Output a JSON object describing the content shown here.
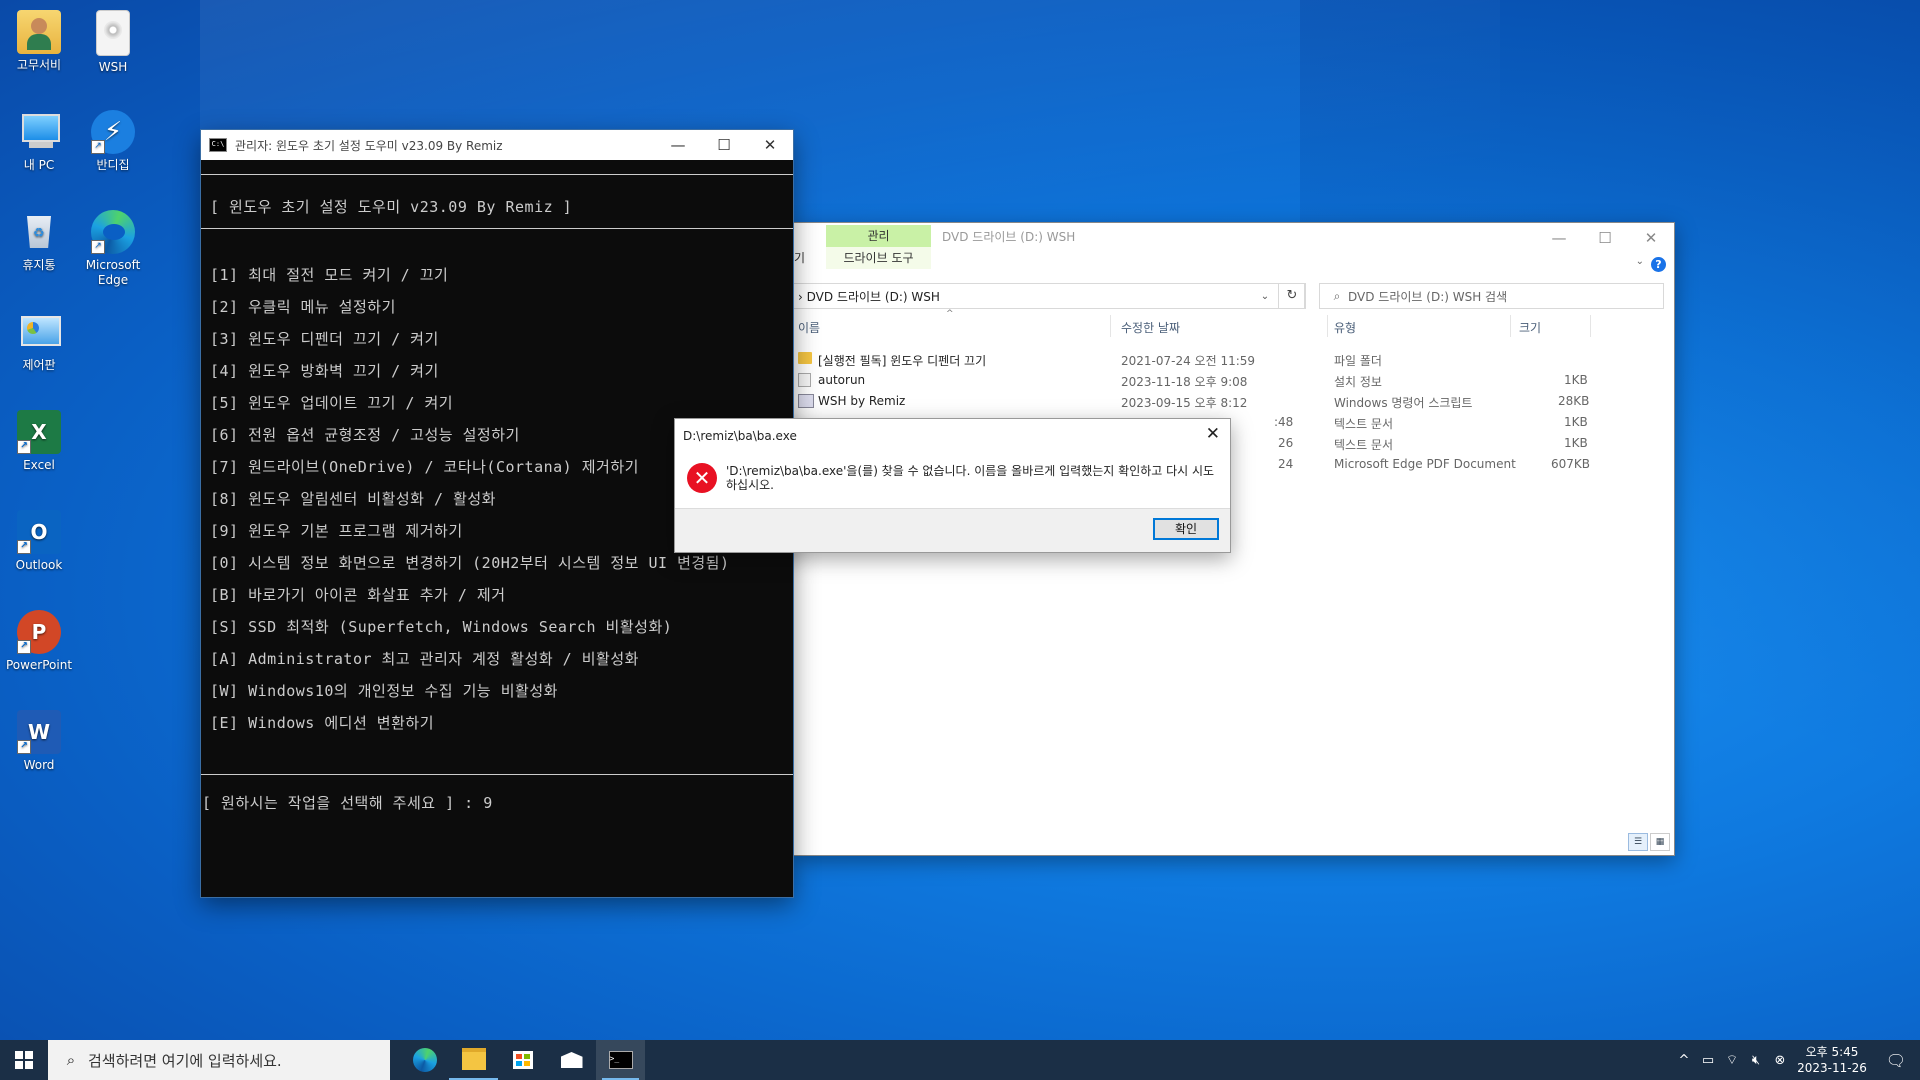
{
  "desktop": {
    "icons": [
      {
        "label": "고무서비"
      },
      {
        "label": "WSH"
      },
      {
        "label": "내 PC"
      },
      {
        "label": "반디집"
      },
      {
        "label": "휴지통"
      },
      {
        "label": "Microsoft Edge"
      },
      {
        "label": "제어판"
      },
      {
        "label": "Excel"
      },
      {
        "label": "Outlook"
      },
      {
        "label": "PowerPoint"
      },
      {
        "label": "Word"
      }
    ]
  },
  "console": {
    "title": "관리자:  윈도우 초기 설정 도우미 v23.09 By Remiz",
    "header": "[ 윈도우 초기 설정 도우미 v23.09 By Remiz ]",
    "menu": [
      "[1] 최대 절전 모드 켜기 / 끄기",
      "[2] 우클릭 메뉴 설정하기",
      "[3] 윈도우 디펜더 끄기 / 켜기",
      "[4] 윈도우 방화벽 끄기 / 켜기",
      "[5] 윈도우 업데이트 끄기 / 켜기",
      "[6] 전원 옵션 균형조정 / 고성능 설정하기",
      "[7] 원드라이브(OneDrive) / 코타나(Cortana) 제거하기",
      "[8] 윈도우 알림센터 비활성화 / 활성화",
      "[9] 윈도우 기본 프로그램 제거하기",
      "[0] 시스템 정보 화면으로 변경하기 (20H2부터 시스템 정보 UI 변경됨)",
      "[B] 바로가기 아이콘 화살표 추가 / 제거",
      "[S] SSD 최적화 (Superfetch, Windows Search 비활성화)",
      "[A] Administrator 최고 관리자 계정 활성화 / 비활성화",
      "[W] Windows10의 개인정보 수집 기능 비활성화",
      "[E] Windows 에디션 변환하기"
    ],
    "prompt": "[ 원하시는 작업을 선택해 주세요 ] : 9"
  },
  "explorer": {
    "ribbon_tab": "관리",
    "ribbon_sub": "드라이브 도구",
    "left_trunc": "기",
    "title": "DVD 드라이브 (D:) WSH",
    "address": "DVD 드라이브 (D:) WSH",
    "search_placeholder": "DVD 드라이브 (D:) WSH 검색",
    "columns": {
      "name": "이름",
      "date": "수정한 날짜",
      "type": "유형",
      "size": "크기"
    },
    "files": [
      {
        "name": "[실행전 필독] 윈도우 디펜더 끄기",
        "date": "2021-07-24 오전 11:59",
        "type": "파일 폴더",
        "size": "",
        "icon": "folder-icon"
      },
      {
        "name": "autorun",
        "date": "2023-11-18 오후 9:08",
        "type": "설치 정보",
        "size": "1KB",
        "icon": "settings-file-icon"
      },
      {
        "name": "WSH by Remiz",
        "date": "2023-09-15 오후 8:12",
        "type": "Windows 명령어 스크립트",
        "size": "28KB",
        "icon": "script-icon"
      },
      {
        "name": "",
        "date": ":48",
        "type": "텍스트 문서",
        "size": "1KB",
        "icon": "text-file-icon"
      },
      {
        "name": "",
        "date": "26",
        "type": "텍스트 문서",
        "size": "1KB",
        "icon": ""
      },
      {
        "name": "",
        "date": "24",
        "type": "Microsoft Edge PDF Document",
        "size": "607KB",
        "icon": ""
      }
    ]
  },
  "dialog": {
    "title": "D:\\remiz\\ba\\ba.exe",
    "message": "'D:\\remiz\\ba\\ba.exe'을(를) 찾을 수 없습니다. 이름을 올바르게 입력했는지 확인하고 다시 시도하십시오.",
    "ok_label": "확인"
  },
  "taskbar": {
    "search_placeholder": "검색하려면 여기에 입력하세요.",
    "time": "오후 5:45",
    "date": "2023-11-26"
  },
  "colors": {
    "console_bg": "#0c0c0c",
    "console_text": "#cccccc",
    "ribbon_manage": "#c9f1a6",
    "error_red": "#e81123",
    "accent": "#0078d7",
    "taskbar": "#1b2f46"
  }
}
